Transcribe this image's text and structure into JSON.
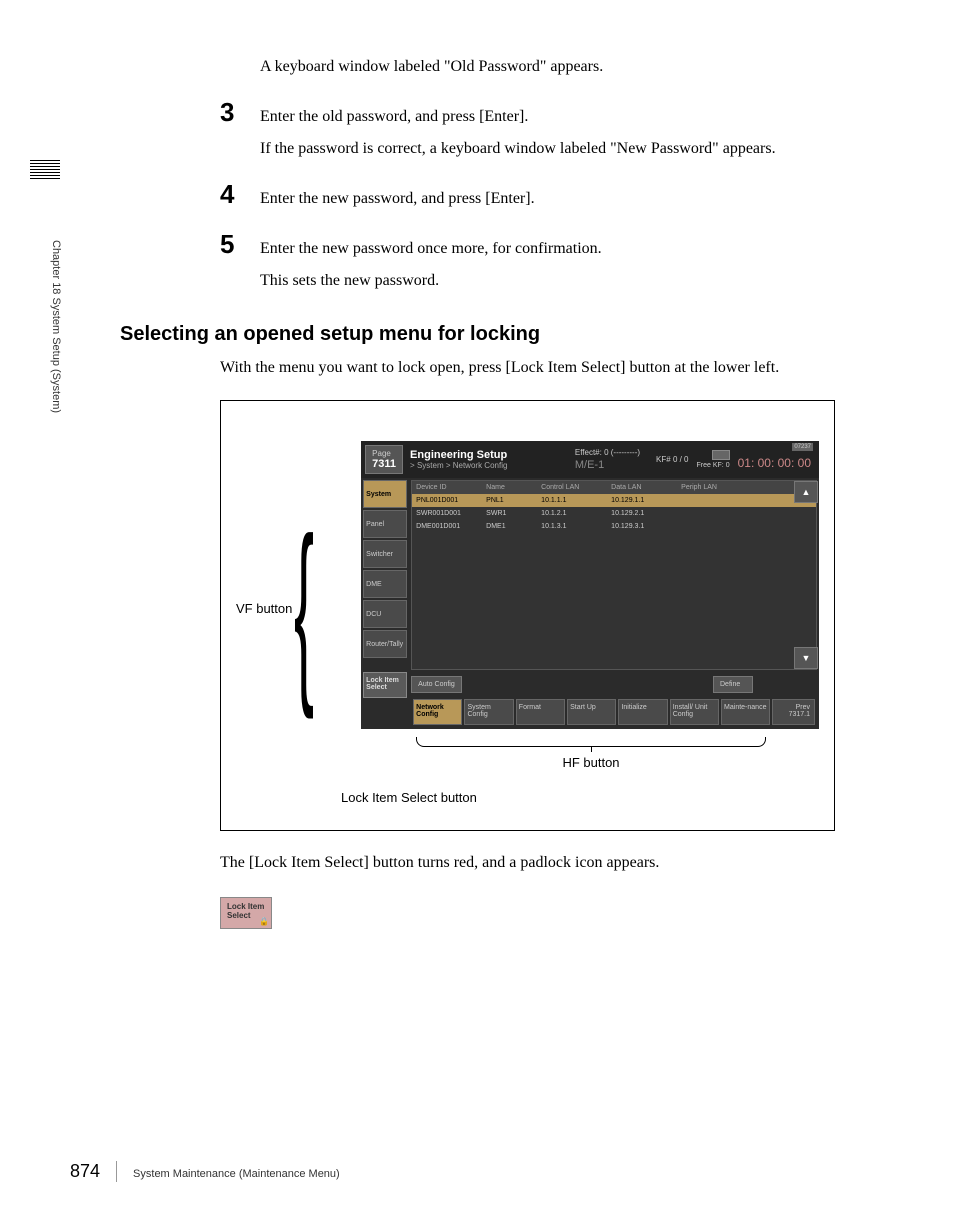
{
  "sidebar": {
    "chapter": "Chapter 18  System Setup (System)"
  },
  "intro": {
    "old_pw_appears": "A keyboard window labeled \"Old Password\" appears."
  },
  "steps": {
    "s3": {
      "num": "3",
      "text": "Enter the old password, and press [Enter].",
      "result": "If the password is correct, a keyboard window labeled \"New Password\" appears."
    },
    "s4": {
      "num": "4",
      "text": "Enter the new password, and press [Enter]."
    },
    "s5": {
      "num": "5",
      "text": "Enter the new password once more, for confirmation.",
      "result": "This sets the new password."
    }
  },
  "section": {
    "heading": "Selecting an opened setup menu for locking",
    "body": "With the menu you want to lock open, press [Lock Item Select] button at the lower left."
  },
  "figure": {
    "vf_label": "VF button",
    "hf_label": "HF button",
    "lock_label": "Lock Item Select button"
  },
  "ui": {
    "page_label": "Page",
    "page_num": "7311",
    "title": "Engineering Setup",
    "breadcrumb": "> System > Network Config",
    "effect": "Effect#: 0 (---------)",
    "me": "M/E-1",
    "kf": "KF# 0 / 0",
    "free_kf": "Free KF: 0",
    "time": "01: 00: 00: 00",
    "small_code": "07237",
    "vf_buttons": [
      "System",
      "Panel",
      "Switcher",
      "DME",
      "DCU",
      "Router/Tally"
    ],
    "lock_item": "Lock Item Select",
    "table": {
      "headers": [
        "Device ID",
        "Name",
        "Control LAN",
        "Data LAN",
        "Periph LAN"
      ],
      "rows": [
        [
          "PNL001D001",
          "PNL1",
          "10.1.1.1",
          "10.129.1.1",
          ""
        ],
        [
          "SWR001D001",
          "SWR1",
          "10.1.2.1",
          "10.129.2.1",
          ""
        ],
        [
          "DME001D001",
          "DME1",
          "10.1.3.1",
          "10.129.3.1",
          ""
        ]
      ]
    },
    "actions": {
      "auto": "Auto Config",
      "define": "Define"
    },
    "hf_buttons": [
      "Network Config",
      "System Config",
      "Format",
      "Start Up",
      "Initialize",
      "Install/ Unit Config",
      "Mainte-nance"
    ],
    "prev": "Prev",
    "prev_num": "7317.1"
  },
  "post_figure": {
    "text": "The [Lock Item Select] button turns red, and a padlock icon appears.",
    "lock_label": "Lock Item Select"
  },
  "footer": {
    "page_num": "874",
    "title": "System Maintenance (Maintenance Menu)"
  }
}
